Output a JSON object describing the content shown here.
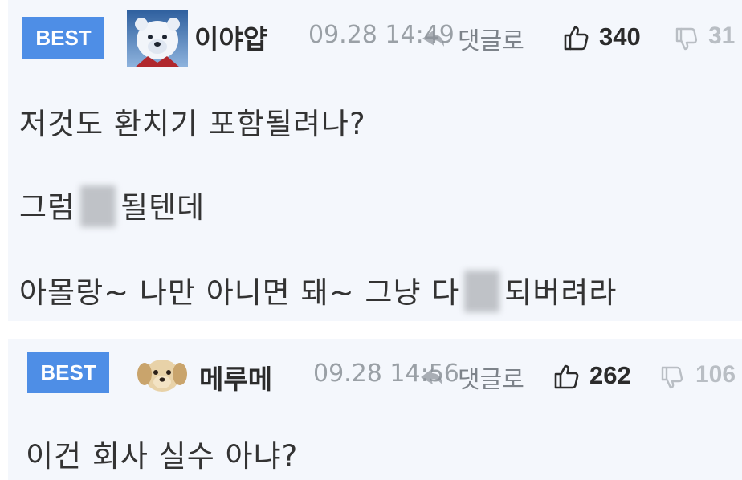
{
  "comments": [
    {
      "badge": "BEST",
      "nickname": "이야얍",
      "date": "09.28 14:49",
      "reply_label": "댓글로",
      "likes": "340",
      "dislikes": "31",
      "body": {
        "line1": "저것도 환치기 포함될려나?",
        "line2_pre": "그럼",
        "line2_post": "될텐데",
        "line3_pre": "아몰랑~ 나만 아니면 돼~ 그냥 다",
        "line3_post": "되버려라"
      }
    },
    {
      "badge": "BEST",
      "nickname": "메루메",
      "date": "09.28 14:56",
      "reply_label": "댓글로",
      "likes": "262",
      "dislikes": "106",
      "body": {
        "line1": "이건 회사 실수 아냐?"
      }
    }
  ],
  "colors": {
    "badge_bg": "#4e8ee6",
    "card_bg": "#f4f7fc",
    "muted_text": "#9aa0a6",
    "body_text": "#333333"
  },
  "icons": {
    "reply": "reply-arrow-icon",
    "like": "thumbs-up-icon",
    "dislike": "thumbs-down-icon"
  }
}
